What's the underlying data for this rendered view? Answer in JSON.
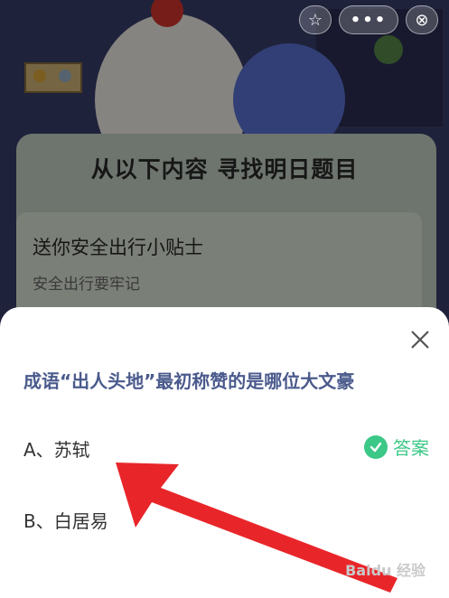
{
  "header": {
    "favorite_icon": "star-icon",
    "more_icon": "more-icon",
    "more_label": "•••",
    "close_icon": "close-circle-icon"
  },
  "background": {
    "banner": "从以下内容 寻找明日题目",
    "tip_title": "送你安全出行小贴士",
    "tip_subtitle": "安全出行要牢记"
  },
  "quiz": {
    "question": "成语“出人头地”最初称赞的是哪位大文豪",
    "options": [
      {
        "label": "A、苏轼",
        "is_answer": true
      },
      {
        "label": "B、白居易",
        "is_answer": false
      }
    ],
    "answer_label": "答案"
  },
  "watermark": "Baidu 经验",
  "colors": {
    "accent_green": "#3cc887",
    "question_blue": "#4a5a8c",
    "arrow_red": "#e8262a"
  }
}
